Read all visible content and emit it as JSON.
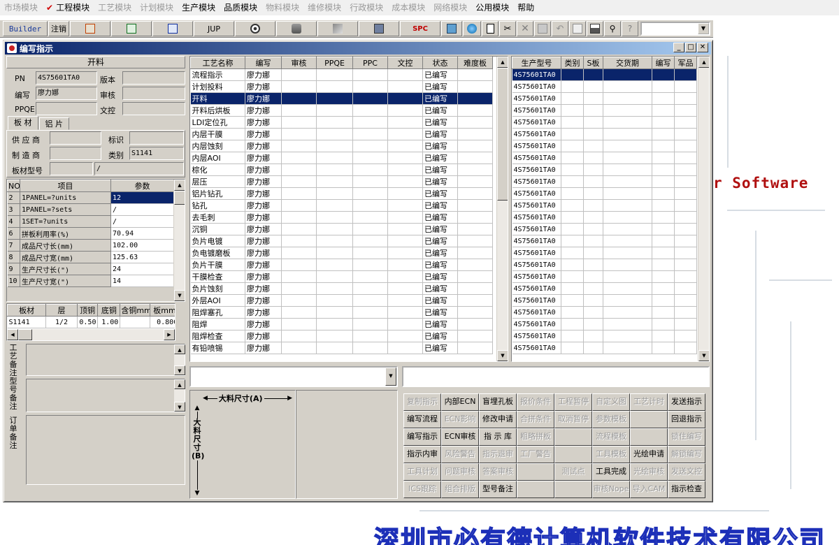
{
  "menubar": {
    "items": [
      {
        "label": "市场模块",
        "enabled": false
      },
      {
        "label": "工程模块",
        "enabled": true,
        "checked": true
      },
      {
        "label": "工艺模块",
        "enabled": false
      },
      {
        "label": "计划模块",
        "enabled": false
      },
      {
        "label": "生产模块",
        "enabled": true
      },
      {
        "label": "品质模块",
        "enabled": true
      },
      {
        "label": "物料模块",
        "enabled": false
      },
      {
        "label": "维修模块",
        "enabled": false
      },
      {
        "label": "行政模块",
        "enabled": false
      },
      {
        "label": "成本模块",
        "enabled": false
      },
      {
        "label": "网络模块",
        "enabled": false
      },
      {
        "label": "公用模块",
        "enabled": true
      },
      {
        "label": "帮助",
        "enabled": true
      }
    ]
  },
  "toolbar": {
    "builder_label": "Builder",
    "logout_label": "注销",
    "jup_label": "JUP",
    "spc_label": "SPC",
    "combo_value": ""
  },
  "window": {
    "title": "编写指示"
  },
  "left": {
    "section_title": "开料",
    "pn_label": "PN",
    "pn_value": "4S75601TA0",
    "version_label": "版本",
    "version_value": "",
    "writer_label": "编写",
    "writer_value": "廖力娜",
    "audit_label": "审核",
    "audit_value": "",
    "ppqe_label": "PPQE",
    "ppqe_value": "",
    "wenkong_label": "文控",
    "wenkong_value": "",
    "tabs": [
      "板 材",
      "铝 片"
    ],
    "supplier_label": "供 应 商",
    "supplier_value": "",
    "mark_label": "标识",
    "mark_value": "",
    "maker_label": "制 造 商",
    "maker_value": "",
    "category_label": "类别",
    "category_value": "S1141",
    "model_label": "板材型号",
    "model_value": "",
    "model_value2": "/",
    "param_headers": [
      "NO",
      "项目",
      "参数"
    ],
    "params": [
      {
        "no": "2",
        "item": "1PANEL=?units",
        "value": "12"
      },
      {
        "no": "3",
        "item": "1PANEL=?sets",
        "value": "/"
      },
      {
        "no": "4",
        "item": "1SET=?units",
        "value": "/"
      },
      {
        "no": "6",
        "item": "拼板利用率(%)",
        "value": "70.94"
      },
      {
        "no": "7",
        "item": "成品尺寸长(mm)",
        "value": "102.00"
      },
      {
        "no": "8",
        "item": "成品尺寸宽(mm)",
        "value": "125.63"
      },
      {
        "no": "9",
        "item": "生产尺寸长(\")",
        "value": "24"
      },
      {
        "no": "10",
        "item": "生产尺寸宽(\")",
        "value": "14"
      }
    ],
    "mat_headers": [
      "板材",
      "层",
      "顶铜",
      "底铜",
      "含铜mm",
      "板mm",
      "板"
    ],
    "mat_rows": [
      {
        "c": [
          "S1141",
          "1/2",
          "0.50",
          "1.00",
          "",
          "0.800",
          ""
        ]
      }
    ],
    "memo_labels": [
      "工艺备注",
      "型号备注",
      "订单备注"
    ]
  },
  "process": {
    "headers": [
      "工艺名称",
      "编写",
      "审核",
      "PPQE",
      "PPC",
      "文控",
      "状态",
      "难度板"
    ],
    "rows": [
      {
        "name": "流程指示",
        "writer": "廖力娜",
        "status": "已编写"
      },
      {
        "name": "计划投料",
        "writer": "廖力娜",
        "status": "已编写"
      },
      {
        "name": "开料",
        "writer": "廖力娜",
        "status": "已编写"
      },
      {
        "name": "开料后烘板",
        "writer": "廖力娜",
        "status": "已编写"
      },
      {
        "name": "LDI定位孔",
        "writer": "廖力娜",
        "status": "已编写"
      },
      {
        "name": "内层干膜",
        "writer": "廖力娜",
        "status": "已编写"
      },
      {
        "name": "内层蚀刻",
        "writer": "廖力娜",
        "status": "已编写"
      },
      {
        "name": "内层AOI",
        "writer": "廖力娜",
        "status": "已编写"
      },
      {
        "name": "棕化",
        "writer": "廖力娜",
        "status": "已编写"
      },
      {
        "name": "层压",
        "writer": "廖力娜",
        "status": "已编写"
      },
      {
        "name": "铝片钻孔",
        "writer": "廖力娜",
        "status": "已编写"
      },
      {
        "name": "钻孔",
        "writer": "廖力娜",
        "status": "已编写"
      },
      {
        "name": "去毛刺",
        "writer": "廖力娜",
        "status": "已编写"
      },
      {
        "name": "沉铜",
        "writer": "廖力娜",
        "status": "已编写"
      },
      {
        "name": "负片电镀",
        "writer": "廖力娜",
        "status": "已编写"
      },
      {
        "name": "负电镀磨板",
        "writer": "廖力娜",
        "status": "已编写"
      },
      {
        "name": "负片干膜",
        "writer": "廖力娜",
        "status": "已编写"
      },
      {
        "name": "干膜检查",
        "writer": "廖力娜",
        "status": "已编写"
      },
      {
        "name": "负片蚀刻",
        "writer": "廖力娜",
        "status": "已编写"
      },
      {
        "name": "外层AOI",
        "writer": "廖力娜",
        "status": "已编写"
      },
      {
        "name": "阻焊塞孔",
        "writer": "廖力娜",
        "status": "已编写"
      },
      {
        "name": "阻焊",
        "writer": "廖力娜",
        "status": "已编写"
      },
      {
        "name": "阻焊检查",
        "writer": "廖力娜",
        "status": "已编写"
      },
      {
        "name": "有铅喷锡",
        "writer": "廖力娜",
        "status": "已编写"
      }
    ]
  },
  "models": {
    "headers": [
      "生产型号",
      "类别",
      "S板",
      "交货期",
      "编写",
      "军品"
    ],
    "value": "4S75601TA0",
    "count": 24
  },
  "bottom": {
    "combo1_value": "",
    "combo2_value": "",
    "dim_a_label": "大料尺寸(A)",
    "dim_b_label": "大料尺寸(B)"
  },
  "actions": [
    [
      "复制指示",
      "内部ECN",
      "盲埋孔板",
      "报价条件",
      "工程暂停",
      "自定义图",
      "工艺计时",
      "发送指示"
    ],
    [
      "编写流程",
      "ECN影响",
      "修改申请",
      "合拼条件",
      "取消暂停",
      "参数模板",
      "",
      "回退指示"
    ],
    [
      "编写指示",
      "ECN审核",
      "指 示 库",
      "粗略拼板",
      "",
      "流程模板",
      "",
      "锁住编写"
    ],
    [
      "指示内审",
      "风险警告",
      "指示退审",
      "工厂警告",
      "",
      "工具模板",
      "光绘申请",
      "解锁编写"
    ],
    [
      "工具计划",
      "问题审核",
      "答案审核",
      "",
      "测试点",
      "工具完成",
      "光绘审核",
      "发送文控"
    ],
    [
      "ICS跟踪",
      "组合排版",
      "型号备注",
      "",
      "",
      "审核Nope",
      "导入CAM",
      "指示检查"
    ]
  ],
  "actions_enabled": [
    [
      0,
      1,
      1,
      0,
      0,
      0,
      0,
      1
    ],
    [
      1,
      0,
      1,
      0,
      0,
      0,
      0,
      1
    ],
    [
      1,
      1,
      1,
      0,
      0,
      0,
      0,
      0
    ],
    [
      1,
      0,
      0,
      0,
      0,
      0,
      1,
      0
    ],
    [
      0,
      0,
      0,
      0,
      0,
      1,
      0,
      0
    ],
    [
      0,
      0,
      1,
      0,
      0,
      0,
      0,
      1
    ]
  ],
  "background": {
    "watermark": "r Software",
    "company": "深圳市必有德计算机软件技术有限公司"
  }
}
